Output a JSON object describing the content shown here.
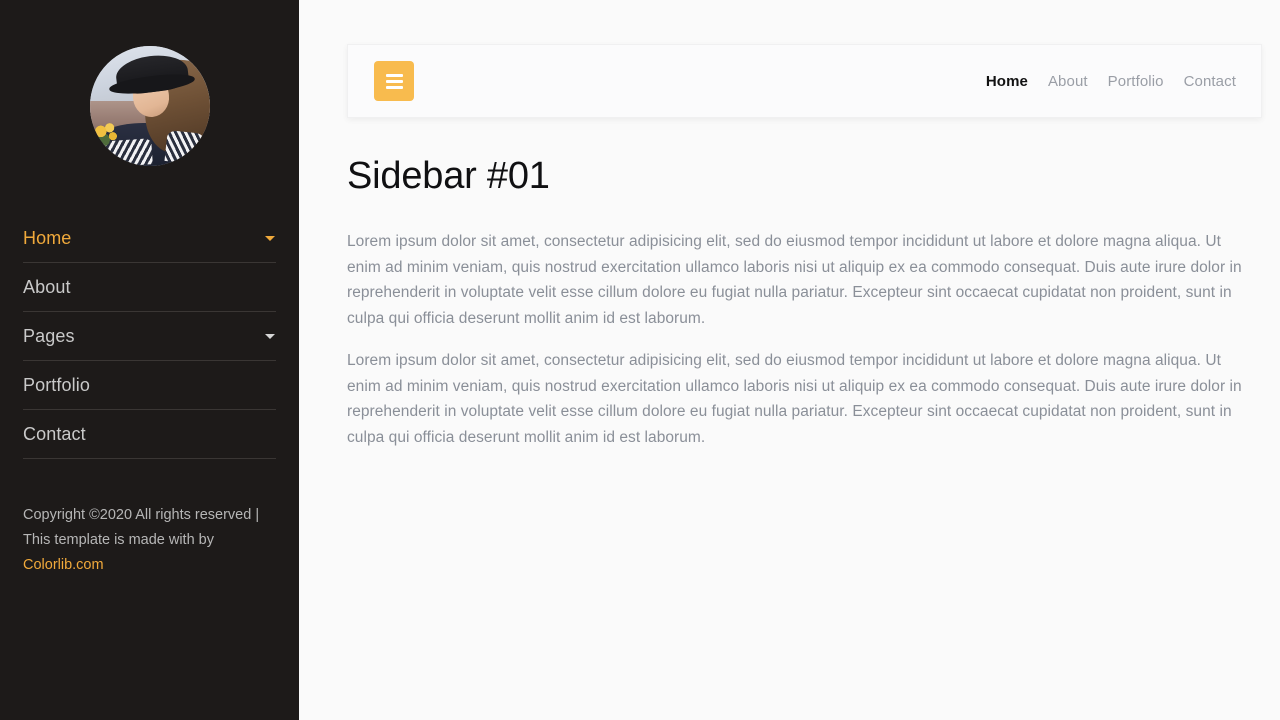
{
  "sidebar": {
    "avatar_alt": "profile-photo",
    "nav_items": [
      {
        "label": "Home",
        "active": true,
        "caret": true
      },
      {
        "label": "About",
        "active": false,
        "caret": false
      },
      {
        "label": "Pages",
        "active": false,
        "caret": true
      },
      {
        "label": "Portfolio",
        "active": false,
        "caret": false
      },
      {
        "label": "Contact",
        "active": false,
        "caret": false
      }
    ],
    "copyright_line1": "Copyright ©2020 All rights reserved |",
    "copyright_line2": "This template is made with by",
    "copyright_link": "Colorlib.com"
  },
  "header": {
    "menu_toggle_label": "menu-toggle",
    "nav_links": [
      {
        "label": "Home",
        "active": true
      },
      {
        "label": "About",
        "active": false
      },
      {
        "label": "Portfolio",
        "active": false
      },
      {
        "label": "Contact",
        "active": false
      }
    ]
  },
  "main": {
    "title": "Sidebar #01",
    "paragraph1": "Lorem ipsum dolor sit amet, consectetur adipisicing elit, sed do eiusmod tempor incididunt ut labore et dolore magna aliqua. Ut enim ad minim veniam, quis nostrud exercitation ullamco laboris nisi ut aliquip ex ea commodo consequat. Duis aute irure dolor in reprehenderit in voluptate velit esse cillum dolore eu fugiat nulla pariatur. Excepteur sint occaecat cupidatat non proident, sunt in culpa qui officia deserunt mollit anim id est laborum.",
    "paragraph2": "Lorem ipsum dolor sit amet, consectetur adipisicing elit, sed do eiusmod tempor incididunt ut labore et dolore magna aliqua. Ut enim ad minim veniam, quis nostrud exercitation ullamco laboris nisi ut aliquip ex ea commodo consequat. Duis aute irure dolor in reprehenderit in voluptate velit esse cillum dolore eu fugiat nulla pariatur. Excepteur sint occaecat cupidatat non proident, sunt in culpa qui officia deserunt mollit anim id est laborum."
  },
  "colors": {
    "sidebar_bg": "#1d1a19",
    "main_bg": "#fafafa",
    "accent": "#f0a93b",
    "burger_bg": "#f8bb4e",
    "body_text": "#8a8f98",
    "nav_text": "#c9c9c9"
  }
}
